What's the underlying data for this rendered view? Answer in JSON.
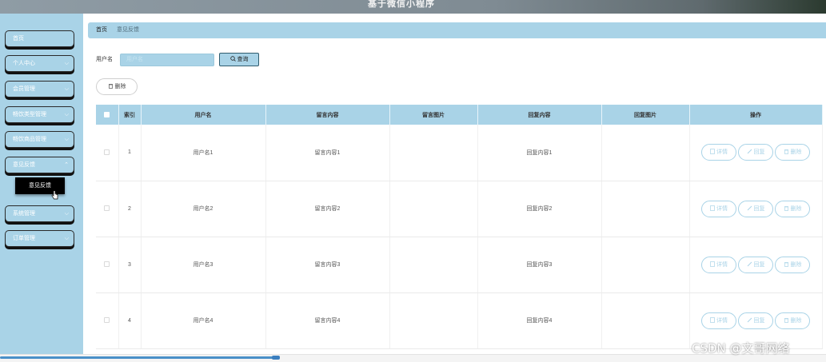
{
  "header": {
    "title": "基于微信小程序"
  },
  "sidebar": {
    "items": [
      {
        "label": "首页",
        "has_chevron": false
      },
      {
        "label": "个人中心",
        "has_chevron": true
      },
      {
        "label": "会员管理",
        "has_chevron": true
      },
      {
        "label": "畅饮类型管理",
        "has_chevron": true
      },
      {
        "label": "畅饮商品管理",
        "has_chevron": true
      },
      {
        "label": "意见反馈",
        "has_chevron": true
      },
      {
        "label": "系统管理",
        "has_chevron": true
      },
      {
        "label": "订单管理",
        "has_chevron": true
      }
    ],
    "submenu": {
      "label": "意见反馈"
    }
  },
  "breadcrumb": {
    "home": "首页",
    "separator": "/",
    "current": "意见反馈"
  },
  "search": {
    "label": "用户名",
    "placeholder": "用户名",
    "button_label": "查询"
  },
  "toolbar": {
    "delete_label": "删除"
  },
  "table": {
    "columns": [
      "",
      "索引",
      "用户名",
      "留言内容",
      "留言图片",
      "回复内容",
      "回复图片",
      "操作"
    ],
    "rows": [
      {
        "index": "1",
        "username": "用户名1",
        "message": "留言内容1",
        "message_image": "",
        "reply": "回复内容1",
        "reply_image": ""
      },
      {
        "index": "2",
        "username": "用户名2",
        "message": "留言内容2",
        "message_image": "",
        "reply": "回复内容2",
        "reply_image": ""
      },
      {
        "index": "3",
        "username": "用户名3",
        "message": "留言内容3",
        "message_image": "",
        "reply": "回复内容3",
        "reply_image": ""
      },
      {
        "index": "4",
        "username": "用户名4",
        "message": "留言内容4",
        "message_image": "",
        "reply": "回复内容4",
        "reply_image": ""
      }
    ],
    "actions": {
      "detail": "详情",
      "reply": "回复",
      "delete": "删除"
    }
  },
  "watermark": "CSDN @文哥网络",
  "colors": {
    "accent": "#a9d3e7",
    "scrollbar": "#4a90c8",
    "header": "#8f9ca5"
  }
}
